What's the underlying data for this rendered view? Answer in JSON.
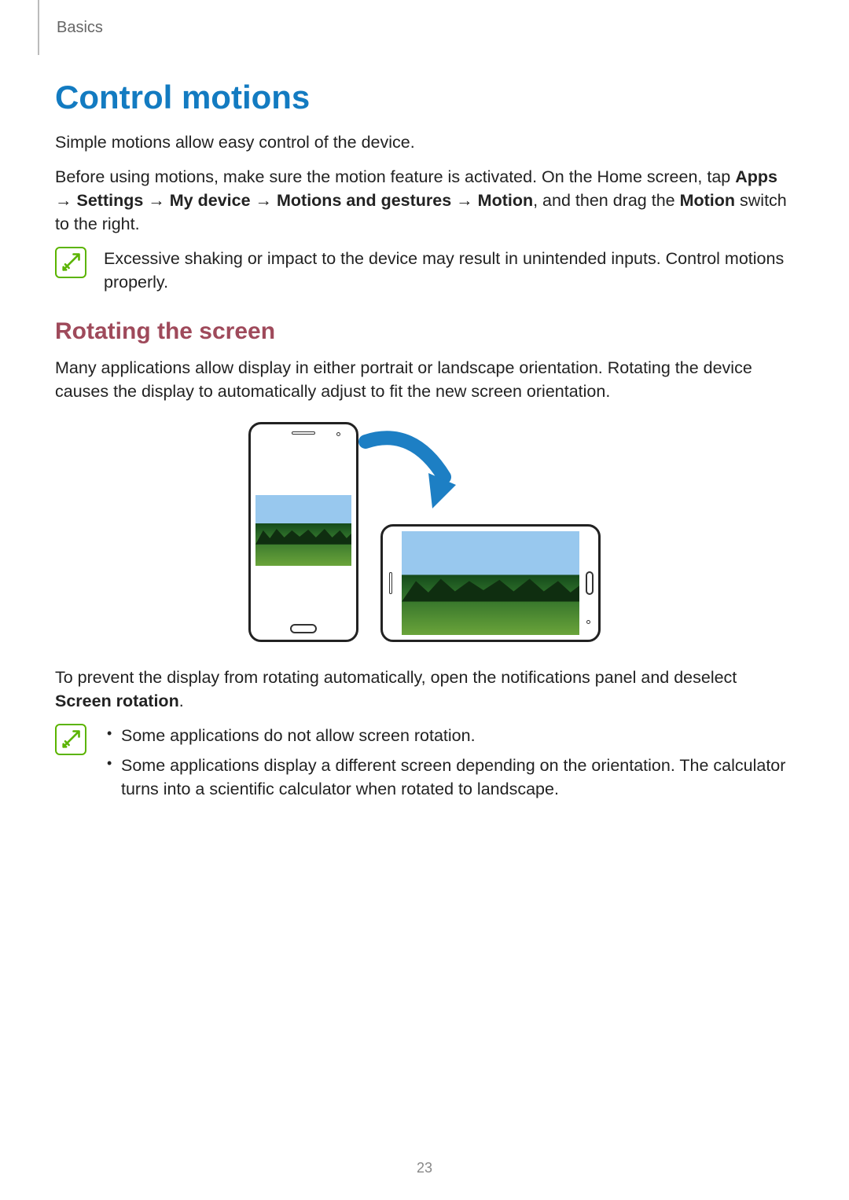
{
  "header": {
    "section": "Basics"
  },
  "h1": "Control motions",
  "intro": "Simple motions allow easy control of the device.",
  "activate": {
    "pre": "Before using motions, make sure the motion feature is activated. On the Home screen, tap ",
    "path_apps": "Apps",
    "path_settings": "Settings",
    "path_mydevice": "My device",
    "path_motions": "Motions and gestures",
    "path_motion": "Motion",
    "mid": ", and then drag the ",
    "switch": "Motion",
    "post": " switch to the right.",
    "arrow": " → "
  },
  "note1": "Excessive shaking or impact to the device may result in unintended inputs. Control motions properly.",
  "h2": "Rotating the screen",
  "rotate_p": "Many applications allow display in either portrait or landscape orientation. Rotating the device causes the display to automatically adjust to fit the new screen orientation.",
  "prevent": {
    "pre": "To prevent the display from rotating automatically, open the notifications panel and deselect ",
    "bold": "Screen rotation",
    "post": "."
  },
  "note2": {
    "b1": "Some applications do not allow screen rotation.",
    "b2": "Some applications display a different screen depending on the orientation. The calculator turns into a scientific calculator when rotated to landscape."
  },
  "page_number": "23"
}
